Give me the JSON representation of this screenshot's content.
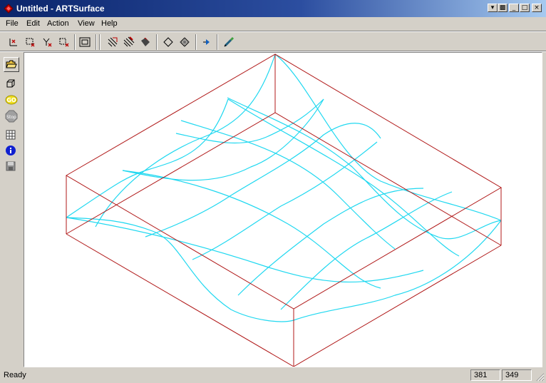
{
  "window": {
    "title": "Untitled - ARTSurface",
    "controls": {
      "minimize": "_",
      "maximize": "□",
      "close": "×"
    }
  },
  "menu": [
    "File",
    "Edit",
    "Action",
    "View",
    "Help"
  ],
  "toolbar": {
    "buttons": [
      "axes-icon",
      "delete-x-icon",
      "delete-y-icon",
      "delete-xy-icon",
      "frame-icon",
      "surface-lines-icon",
      "surface-fill-icon",
      "surface-solid-icon",
      "diamond-icon",
      "grid-diamond-icon",
      "play-icon",
      "pen-icon"
    ]
  },
  "sidebar": {
    "buttons": [
      "open-folder-icon",
      "cube-icon",
      "go-icon",
      "stop-icon",
      "grid-icon",
      "info-icon",
      "save-icon"
    ],
    "go_label": "GO",
    "stop_label": "Stop"
  },
  "status": {
    "text": "Ready",
    "x": "381",
    "y": "349"
  },
  "colors": {
    "box": "#b01818",
    "surface": "#20d8f0",
    "titlebar": "#0a246a"
  }
}
